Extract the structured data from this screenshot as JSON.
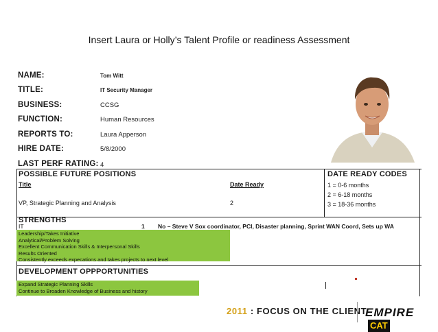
{
  "caption": "Insert Laura or Holly’s Talent Profile or readiness Assessment",
  "profile": {
    "fields": [
      {
        "label": "NAME:",
        "value": "Tom Witt"
      },
      {
        "label": "TITLE:",
        "value": "IT Security Manager"
      },
      {
        "label": "BUSINESS:",
        "value": "CCSG"
      },
      {
        "label": "FUNCTION:",
        "value": "Human Resources"
      },
      {
        "label": "REPORTS TO:",
        "value": "Laura Apperson"
      },
      {
        "label": "HIRE DATE:",
        "value": "5/8/2000"
      },
      {
        "label": "LAST PERF RATING:",
        "value": "4"
      }
    ],
    "positions": {
      "header": "POSSIBLE FUTURE POSITIONS",
      "col_title": "Title",
      "col_date": "Date Ready",
      "rows": [
        {
          "title": "VP, Strategic Planning and Analysis",
          "date_ready": "2"
        }
      ]
    },
    "codes": {
      "header": "DATE READY CODES",
      "items": [
        "1 = 0-6 months",
        "2 = 6-18 months",
        "3 = 18-36 months"
      ]
    },
    "strengths": {
      "header": "STRENGTHS",
      "row_label": "IT",
      "row_num": "1",
      "row_text": "No – Steve V Sox coordinator, PCI, Disaster planning, Sprint WAN Coord, Sets up WA",
      "items": [
        "Leadership/Takes Initiative",
        "Analytical/Problem Solving",
        "Excellent Communication Skills & Interpersonal Skills",
        "Results Oriented",
        "Consistently exceeds expecations and takes projects to next level"
      ]
    },
    "development": {
      "header": "DEVELOPMENT OPPPORTUNITIES",
      "items": [
        "Expand Strategic Planning Skills",
        "Continue to Broaden Knowledge of Business and history"
      ]
    }
  },
  "footer": {
    "year": "2011",
    "slogan": " : FOCUS ON THE CLIENT",
    "brand": "EMPIRE",
    "brand_badge": "CAT"
  }
}
